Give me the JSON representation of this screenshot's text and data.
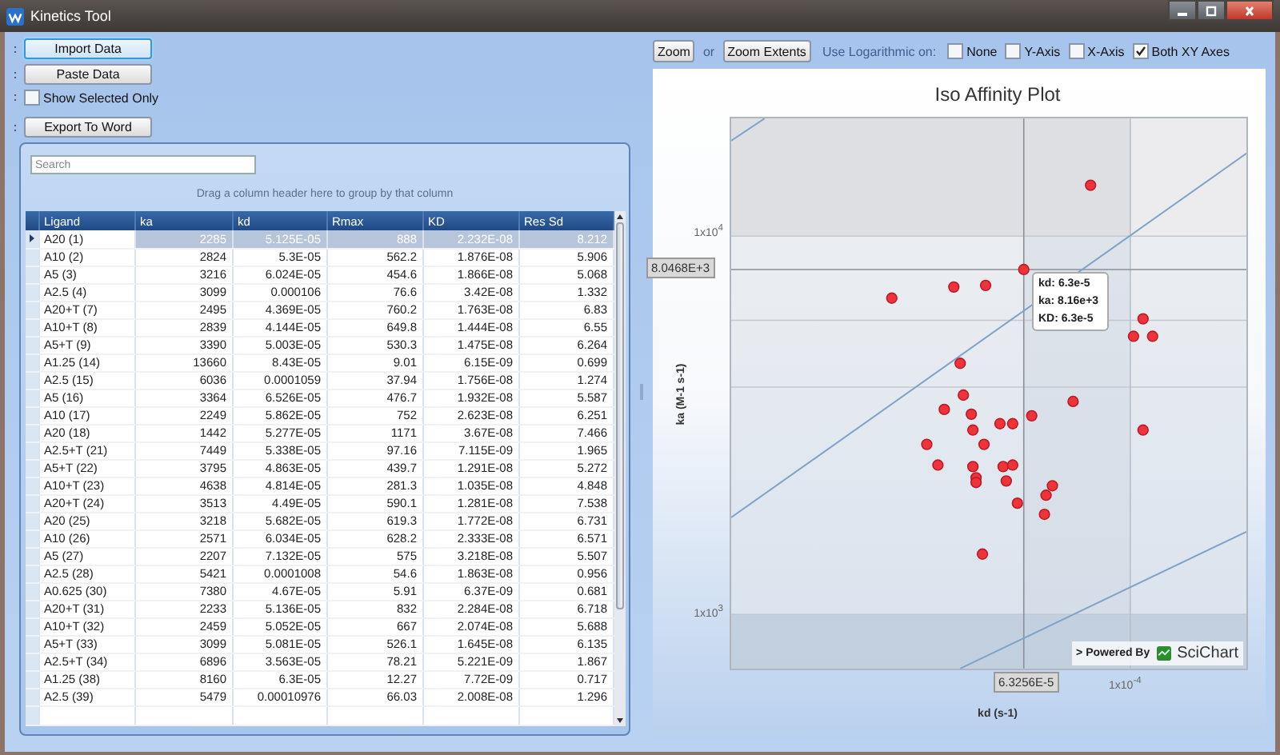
{
  "window": {
    "title": "Kinetics Tool"
  },
  "left_toolbar": {
    "buttons": [
      {
        "label": "Import Data",
        "focused": true
      },
      {
        "label": "Paste Data",
        "focused": false
      }
    ],
    "show_selected_only": {
      "label": "Show Selected Only",
      "checked": false
    },
    "export_button": {
      "label": "Export To Word",
      "focused": false
    }
  },
  "grid": {
    "search": {
      "placeholder": "Search"
    },
    "group_hint": "Drag a column header here to group by that column",
    "columns": [
      "Ligand",
      "ka",
      "kd",
      "Rmax",
      "KD",
      "Res Sd"
    ],
    "rows": [
      {
        "cells": [
          "A20 (1)",
          "2285",
          "5.125E-05",
          "888",
          "2.232E-08",
          "8.212"
        ],
        "selected": true
      },
      {
        "cells": [
          "A10 (2)",
          "2824",
          "5.3E-05",
          "562.2",
          "1.876E-08",
          "5.906"
        ],
        "selected": false
      },
      {
        "cells": [
          "A5 (3)",
          "3216",
          "6.024E-05",
          "454.6",
          "1.866E-08",
          "5.068"
        ],
        "selected": false
      },
      {
        "cells": [
          "A2.5 (4)",
          "3099",
          "0.000106",
          "76.6",
          "3.42E-08",
          "1.332"
        ],
        "selected": false
      },
      {
        "cells": [
          "A20+T (7)",
          "2495",
          "4.369E-05",
          "760.2",
          "1.763E-08",
          "6.83"
        ],
        "selected": false
      },
      {
        "cells": [
          "A10+T (8)",
          "2839",
          "4.144E-05",
          "649.8",
          "1.444E-08",
          "6.55"
        ],
        "selected": false
      },
      {
        "cells": [
          "A5+T (9)",
          "3390",
          "5.003E-05",
          "530.3",
          "1.475E-08",
          "6.264"
        ],
        "selected": false
      },
      {
        "cells": [
          "A1.25 (14)",
          "13660",
          "8.43E-05",
          "9.01",
          "6.15E-09",
          "0.699"
        ],
        "selected": false
      },
      {
        "cells": [
          "A2.5 (15)",
          "6036",
          "0.0001059",
          "37.94",
          "1.756E-08",
          "1.274"
        ],
        "selected": false
      },
      {
        "cells": [
          "A5 (16)",
          "3364",
          "6.526E-05",
          "476.7",
          "1.932E-08",
          "5.587"
        ],
        "selected": false
      },
      {
        "cells": [
          "A10 (17)",
          "2249",
          "5.862E-05",
          "752",
          "2.623E-08",
          "6.251"
        ],
        "selected": false
      },
      {
        "cells": [
          "A20 (18)",
          "1442",
          "5.277E-05",
          "1171",
          "3.67E-08",
          "7.466"
        ],
        "selected": false
      },
      {
        "cells": [
          "A2.5+T (21)",
          "7449",
          "5.338E-05",
          "97.16",
          "7.115E-09",
          "1.965"
        ],
        "selected": false
      },
      {
        "cells": [
          "A5+T (22)",
          "3795",
          "4.863E-05",
          "439.7",
          "1.291E-08",
          "5.272"
        ],
        "selected": false
      },
      {
        "cells": [
          "A10+T (23)",
          "4638",
          "4.814E-05",
          "281.3",
          "1.035E-08",
          "4.848"
        ],
        "selected": false
      },
      {
        "cells": [
          "A20+T (24)",
          "3513",
          "4.49E-05",
          "590.1",
          "1.281E-08",
          "7.538"
        ],
        "selected": false
      },
      {
        "cells": [
          "A20 (25)",
          "3218",
          "5.682E-05",
          "619.3",
          "1.772E-08",
          "6.731"
        ],
        "selected": false
      },
      {
        "cells": [
          "A10 (26)",
          "2571",
          "6.034E-05",
          "628.2",
          "2.333E-08",
          "6.571"
        ],
        "selected": false
      },
      {
        "cells": [
          "A5 (27)",
          "2207",
          "7.132E-05",
          "575",
          "3.218E-08",
          "5.507"
        ],
        "selected": false
      },
      {
        "cells": [
          "A2.5 (28)",
          "5421",
          "0.0001008",
          "54.6",
          "1.863E-08",
          "0.956"
        ],
        "selected": false
      },
      {
        "cells": [
          "A0.625 (30)",
          "7380",
          "4.67E-05",
          "5.91",
          "6.37E-09",
          "0.681"
        ],
        "selected": false
      },
      {
        "cells": [
          "A20+T (31)",
          "2233",
          "5.136E-05",
          "832",
          "2.284E-08",
          "6.718"
        ],
        "selected": false
      },
      {
        "cells": [
          "A10+T (32)",
          "2459",
          "5.052E-05",
          "667",
          "2.074E-08",
          "5.688"
        ],
        "selected": false
      },
      {
        "cells": [
          "A5+T (33)",
          "3099",
          "5.081E-05",
          "526.1",
          "1.645E-08",
          "6.135"
        ],
        "selected": false
      },
      {
        "cells": [
          "A2.5+T (34)",
          "6896",
          "3.563E-05",
          "78.21",
          "5.221E-09",
          "1.867"
        ],
        "selected": false
      },
      {
        "cells": [
          "A1.25 (38)",
          "8160",
          "6.3E-05",
          "12.27",
          "7.72E-09",
          "0.717"
        ],
        "selected": false
      },
      {
        "cells": [
          "A2.5 (39)",
          "5479",
          "0.00010976",
          "66.03",
          "2.008E-08",
          "1.296"
        ],
        "selected": false
      }
    ]
  },
  "chart_toolbar": {
    "zoom": "Zoom",
    "or": "or",
    "zoom_extents": "Zoom Extents",
    "log_label": "Use Logarithmic on:",
    "log_options": [
      {
        "label": "None",
        "checked": false
      },
      {
        "label": "Y-Axis",
        "checked": false
      },
      {
        "label": "X-Axis",
        "checked": false
      },
      {
        "label": "Both XY Axes",
        "checked": true
      }
    ]
  },
  "chart": {
    "title": "Iso Affinity Plot",
    "ylabel": "ka (M-1 s-1)",
    "xlabel": "kd (s-1)",
    "yticks": [
      "1x10$^{4}$",
      "1x10$^{3}$"
    ],
    "xticks": [
      "1x10$^{-4}$"
    ],
    "crosshair": {
      "y_value": "8.0468E+3",
      "x_value": "6.3256E-5"
    },
    "tooltip": [
      "kd: 6.3e-5",
      "ka: 8.16e+3",
      "KD: 6.3e-5"
    ],
    "branding": {
      "prefix": "> Powered By",
      "name": "SciChart"
    }
  }
}
